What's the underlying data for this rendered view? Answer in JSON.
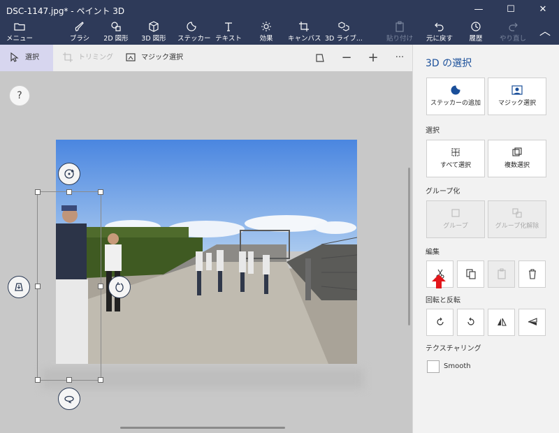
{
  "window": {
    "title": "DSC-1147.jpg* - ペイント 3D",
    "minimize": "—",
    "maximize": "☐",
    "close": "✕"
  },
  "toolbar": {
    "menu": "メニュー",
    "brush": "ブラシ",
    "shapes2d": "2D 図形",
    "shapes3d": "3D 図形",
    "stickers": "ステッカー",
    "text": "テキスト",
    "effects": "効果",
    "canvas": "キャンバス",
    "library3d": "3D ライブ...",
    "paste": "貼り付け",
    "undo": "元に戻す",
    "history": "履歴",
    "redo": "やり直し",
    "collapse": "︿"
  },
  "subbar": {
    "select": "選択",
    "crop": "トリミング",
    "magic_select": "マジック選択",
    "more": "···"
  },
  "canvas": {
    "help": "?"
  },
  "panel": {
    "title": "3D の選択",
    "add_sticker": "ステッカーの追加",
    "magic_select": "マジック選択",
    "select_section": "選択",
    "select_all": "すべて選択",
    "multi_select": "複数選択",
    "group_section": "グループ化",
    "group": "グループ",
    "ungroup": "グループ化解除",
    "edit_section": "編集",
    "rotate_section": "回転と反転",
    "texture_section": "テクスチャリング",
    "smooth": "Smooth",
    "smooth_checked": false
  },
  "colors": {
    "titlebar": "#2e3a59",
    "accent": "#1a4f9a",
    "active_tab": "#d7d6ef",
    "arrow": "#e3161b"
  }
}
